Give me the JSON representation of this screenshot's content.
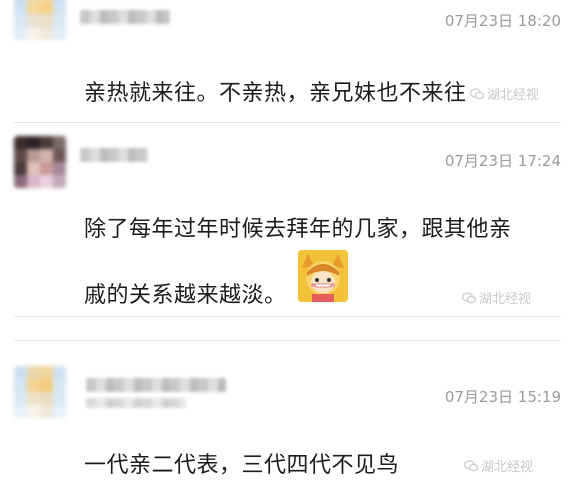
{
  "comments": [
    {
      "time": "07月23日 18:20",
      "text": "亲热就来往。不亲热，亲兄妹也不来往"
    },
    {
      "time": "07月23日 17:24",
      "text_line1": "除了每年过年时候去拜年的几家，跟其他亲",
      "text_line2": "戚的关系越来越淡。"
    },
    {
      "time": "07月23日 15:19",
      "text": "一代亲二代表，三代四代不见鸟"
    }
  ],
  "watermark": {
    "label": "湖北经视"
  },
  "colors": {
    "text": "#1c1c1c",
    "time": "#9b9b9b",
    "divider": "#e6e6e6",
    "watermark": "#c8c8c8"
  }
}
